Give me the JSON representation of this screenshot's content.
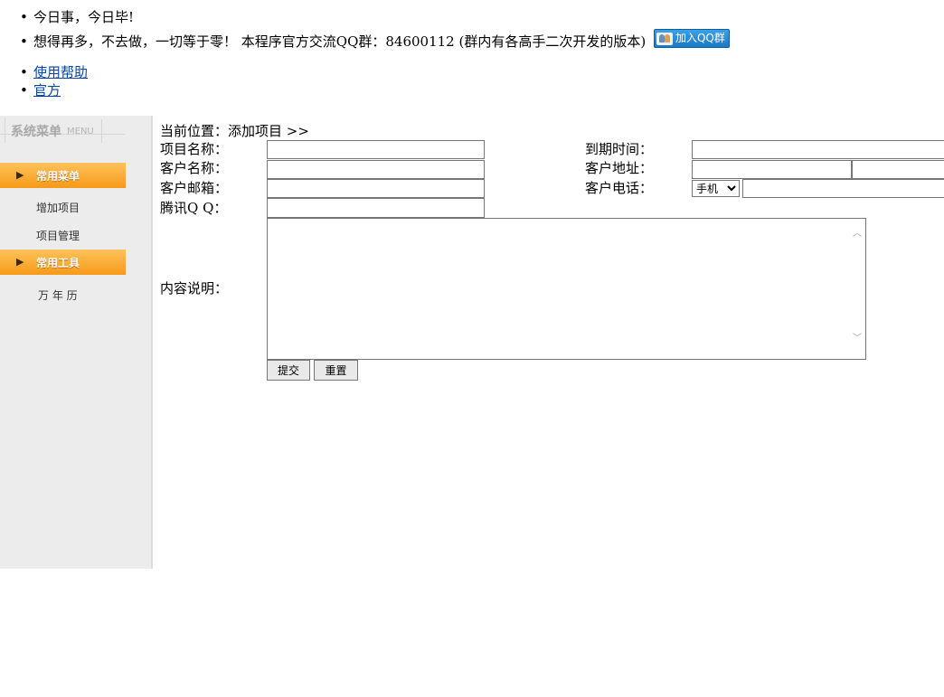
{
  "notices": [
    {
      "text": "今日事，今日毕!"
    },
    {
      "text": "想得再多，不去做，一切等于零！ 本程序官方交流QQ群：84600112 (群内有各高手二次开发的版本)",
      "badge": "加入QQ群"
    }
  ],
  "links": [
    {
      "label": "使用帮助"
    },
    {
      "label": "官方"
    }
  ],
  "sidebar": {
    "title": "系统菜单",
    "title_en": "MENU",
    "categories": [
      {
        "label": "常用菜单",
        "items": [
          "增加项目",
          "项目管理"
        ]
      },
      {
        "label": "常用工具",
        "items": [
          "万 年 历"
        ]
      }
    ]
  },
  "breadcrumb": "当前位置：添加项目 >>",
  "form": {
    "project_name_label": "项目名称：",
    "expire_label": "到期时间：",
    "customer_name_label": "客户名称：",
    "customer_addr_label": "客户地址：",
    "customer_email_label": "客户邮箱：",
    "customer_phone_label": "客户电话：",
    "phone_type_selected": "手机",
    "qq_label": "腾讯Q Q：",
    "content_label": "内容说明：",
    "submit_label": "提交",
    "reset_label": "重置"
  }
}
